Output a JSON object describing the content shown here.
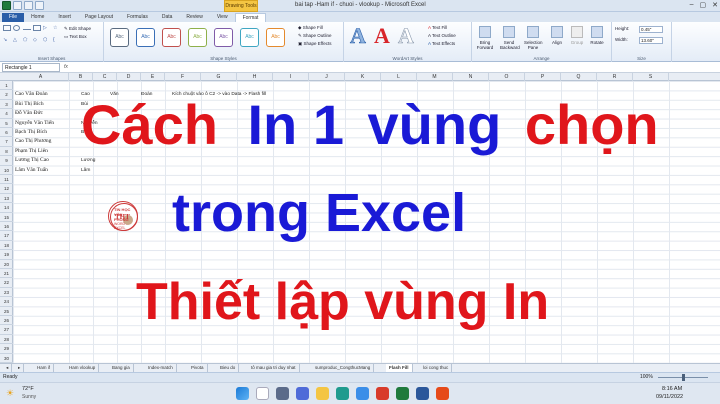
{
  "window": {
    "title": "bai tap -Ham if - chuoi - vlookup - Microsoft Excel",
    "contextual_tab": "Drawing Tools",
    "controls": [
      "–",
      "▢",
      "✕"
    ]
  },
  "ribbon_tabs": [
    "File",
    "Home",
    "Insert",
    "Page Layout",
    "Formulas",
    "Data",
    "Review",
    "View",
    "Format"
  ],
  "ribbon": {
    "insert_shapes": {
      "edit_shape": "Edit Shape",
      "text_box": "Text Box",
      "label": "Insert Shapes"
    },
    "shape_styles": {
      "swatch_text": "Abc",
      "swatch_colors": [
        "#5a6b80",
        "#3b6fb6",
        "#c0504d",
        "#8fb04a",
        "#7f5ba8",
        "#3fa6c2",
        "#e48a2e"
      ],
      "fill": "Shape Fill",
      "outline": "Shape Outline",
      "effects": "Shape Effects",
      "label": "Shape Styles"
    },
    "wordart": {
      "letters": [
        "A",
        "A",
        "A"
      ],
      "text_fill": "Text Fill",
      "text_outline": "Text Outline",
      "text_effects": "Text Effects",
      "label": "WordArt Styles"
    },
    "arrange": {
      "buttons": [
        "Bring Forward",
        "Send Backward",
        "Selection Pane",
        "Align",
        "Group",
        "Rotate"
      ],
      "label": "Arrange"
    },
    "size": {
      "height_label": "Height:",
      "height": "0.45\"",
      "width_label": "Width:",
      "width": "13.60\"",
      "label": "Size"
    }
  },
  "formula_bar": {
    "name_box": "Rectangle 1",
    "fx": "fx"
  },
  "columns": [
    "A",
    "B",
    "C",
    "D",
    "E",
    "F",
    "G",
    "H",
    "I",
    "J",
    "K",
    "L",
    "M",
    "N",
    "O",
    "P",
    "Q",
    "R",
    "S"
  ],
  "rows": [
    "1",
    "2",
    "3",
    "4",
    "5",
    "6",
    "7",
    "8",
    "9",
    "10",
    "11",
    "12",
    "13",
    "14",
    "15",
    "16",
    "17",
    "18",
    "19",
    "20",
    "21",
    "22",
    "23",
    "24",
    "25",
    "26",
    "27",
    "28",
    "29",
    "30"
  ],
  "cells": {
    "col_a": [
      "Cao Văn Đoàn",
      "Bùi Thị Bích",
      "Đỗ Văn Đức",
      "Nguyễn Văn Tiến",
      "Bạch Thị Bích",
      "Cao Thị Phương",
      "Phạm Thị Liên",
      "Lương Thị Cao",
      "Lâm Văn Tuấn"
    ],
    "col_b": [
      "Cao",
      "Bùi",
      "",
      "Nguyễn",
      "Bạch",
      "",
      "",
      "Lương",
      "Lâm"
    ],
    "c2": "Văn",
    "d2": "Đoàn",
    "e2": "Kích chuột vào ô C2 -> vào Data -> Flash fill"
  },
  "overlay": {
    "line1_red": "Cách",
    "line1_blue": "In 1",
    "line1_blue2": "vùng",
    "line1_red2": "chọn",
    "line2_blue": "trong Excel",
    "line3_red": "Thiết lập vùng In",
    "red": "#e0161b",
    "blue": "#1a1ad6"
  },
  "logo": {
    "text": "THT",
    "ring": "TIN HỌC VĂN PHÒNG",
    "sub": "WORD - EXCEL"
  },
  "sheet_tabs": [
    "Ham if",
    "Ham vlookup",
    "Bang gia",
    "Index-match",
    "Pivota",
    "Bieu do",
    "tô mau gia tri duy nhat",
    "sumproduc_CongthucMang",
    "Flash Fill",
    "loi cong thuc"
  ],
  "active_sheet": "Flash Fill",
  "status": {
    "left": "Ready",
    "zoom": "100%"
  },
  "taskbar": {
    "weather_temp": "72°F",
    "weather_desc": "Sunny",
    "time": "8:16 AM",
    "date": "09/11/2022"
  }
}
